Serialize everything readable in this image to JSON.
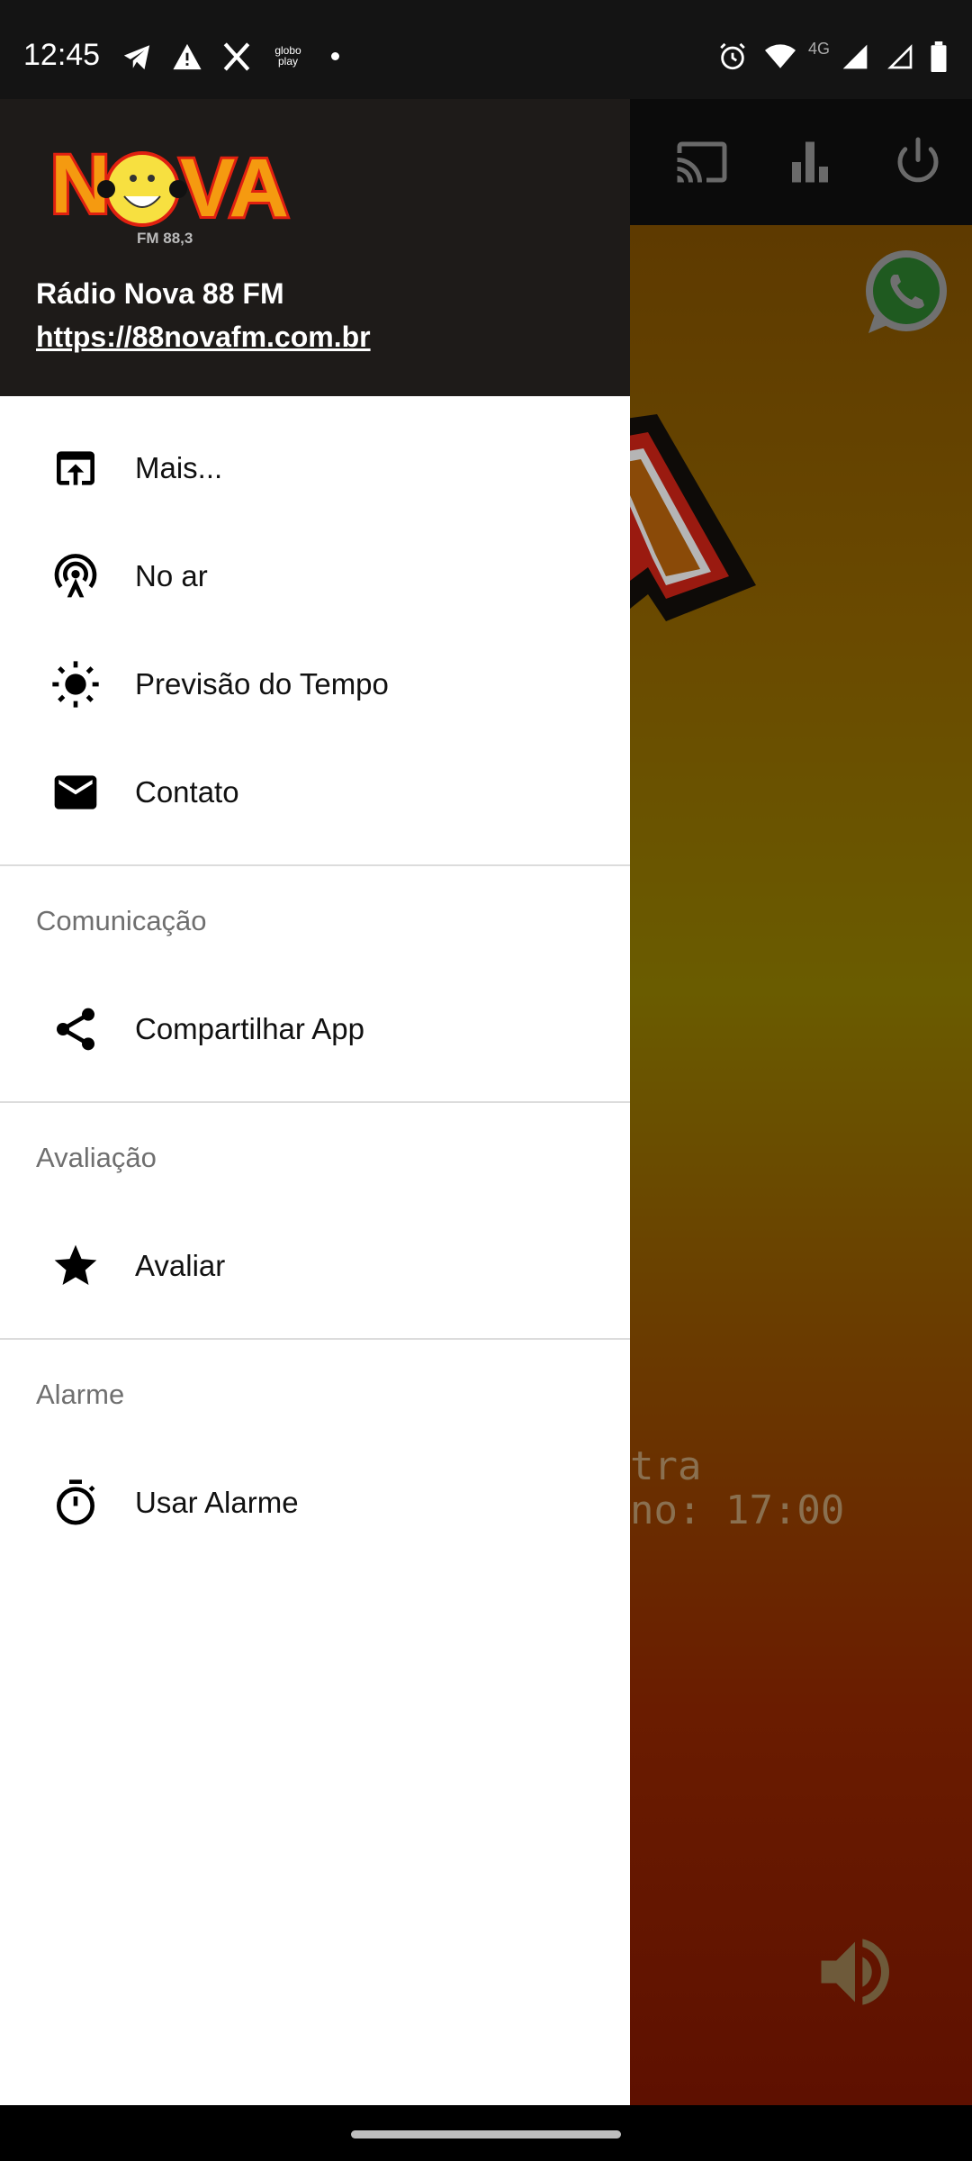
{
  "status_bar": {
    "time": "12:45",
    "left_icons": [
      "telegram-icon",
      "warning-icon",
      "x-icon",
      "globoplay-icon",
      "dot-icon"
    ],
    "globoplay": "globo play",
    "network": "4G",
    "right_icons": [
      "alarm-icon",
      "wifi-icon",
      "signal-icon",
      "signal-icon",
      "battery-icon"
    ]
  },
  "app_bar": {
    "icons": [
      "cast-icon",
      "equalizer-icon",
      "power-icon"
    ]
  },
  "background": {
    "line1": "tra",
    "line2": "no: 17:00",
    "colors": {
      "top": "#5e3a00",
      "bottom": "#5e1000"
    }
  },
  "drawer": {
    "logo_text": "NOVA FM 88,3",
    "station_name": "Rádio Nova 88 FM",
    "url": "https://88novafm.com.br",
    "items": [
      {
        "label": "Mais...",
        "icon": "open-in-browser-icon"
      },
      {
        "label": "No ar",
        "icon": "antenna-icon"
      },
      {
        "label": "Previsão do Tempo",
        "icon": "sun-icon"
      },
      {
        "label": "Contato",
        "icon": "mail-icon"
      }
    ],
    "sections": [
      {
        "title": "Comunicação",
        "items": [
          {
            "label": "Compartilhar App",
            "icon": "share-icon"
          }
        ]
      },
      {
        "title": "Avaliação",
        "items": [
          {
            "label": "Avaliar",
            "icon": "star-icon"
          }
        ]
      },
      {
        "title": "Alarme",
        "items": [
          {
            "label": "Usar Alarme",
            "icon": "timer-icon"
          }
        ]
      }
    ]
  }
}
